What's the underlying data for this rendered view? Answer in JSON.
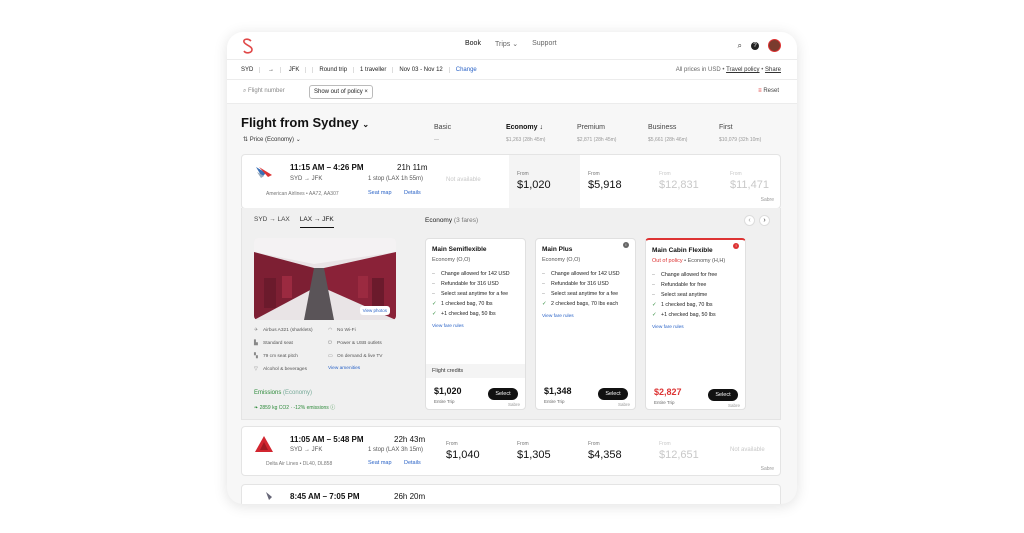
{
  "nav": {
    "links": [
      "Book",
      "Trips",
      "Support"
    ],
    "trips_chevron": "⌄"
  },
  "search": {
    "from": "SYD",
    "to": "JFK",
    "arrow": "→",
    "trip_type": "Round trip",
    "travellers": "1 traveller",
    "dates": "Nov 03 - Nov 12",
    "change": "Change",
    "currency_note": "All prices in USD",
    "dot": "•",
    "travel_policy": "Travel policy",
    "share": "Share"
  },
  "filters": {
    "flight_number_placeholder": "Flight number",
    "chip": "Show out of policy",
    "chip_close": "×",
    "reset": "Reset"
  },
  "page": {
    "title": "Flight from Sydney",
    "title_chevron": "⌄",
    "sort": "Price (Economy)"
  },
  "cabins": [
    {
      "name": "Basic",
      "sub": "—"
    },
    {
      "name": "Economy ↓",
      "sub": "$1,263 (28h 45m)"
    },
    {
      "name": "Premium",
      "sub": "$2,871 (28h 45m)"
    },
    {
      "name": "Business",
      "sub": "$5,661 (28h 46m)"
    },
    {
      "name": "First",
      "sub": "$10,079 (32h 10m)"
    }
  ],
  "flights": [
    {
      "time": "11:15 AM – 4:26 PM",
      "duration": "21h 11m",
      "route": "SYD → JFK",
      "stops": "1 stop (LAX 1h 55m)",
      "airline": "American Airlines • AA72, AA307",
      "seat_map": "Seat map",
      "details": "Details",
      "cells": [
        {
          "from": "",
          "price": "",
          "na": "Not available"
        },
        {
          "from": "From",
          "price": "$1,020"
        },
        {
          "from": "From",
          "price": "$5,918"
        },
        {
          "from": "From",
          "price": "$12,831"
        },
        {
          "from": "From",
          "price": "$11,471"
        }
      ],
      "provider": "Sabre"
    },
    {
      "time": "11:05 AM – 5:48 PM",
      "duration": "22h 43m",
      "route": "SYD → JFK",
      "stops": "1 stop (LAX 3h 15m)",
      "airline": "Delta Air Lines • DL40, DL858",
      "seat_map": "Seat map",
      "details": "Details",
      "cells": [
        {
          "from": "From",
          "price": "$1,040"
        },
        {
          "from": "From",
          "price": "$1,305"
        },
        {
          "from": "From",
          "price": "$4,358"
        },
        {
          "from": "From",
          "price": "$12,651"
        },
        {
          "from": "",
          "price": "",
          "na": "Not available"
        }
      ],
      "provider": "Sabre"
    },
    {
      "time": "8:45 AM – 7:05 PM",
      "duration": "26h 20m"
    }
  ],
  "expanded": {
    "tabs": [
      "SYD → LAX",
      "LAX → JFK"
    ],
    "view_photos": "View photos",
    "amenities": [
      {
        "icon": "plane",
        "text": "Airbus A321 (sharklets)"
      },
      {
        "icon": "wifi",
        "text": "No Wi-Fi"
      },
      {
        "icon": "seat",
        "text": "Standard seat"
      },
      {
        "icon": "power",
        "text": "Power & USB outlets"
      },
      {
        "icon": "pitch",
        "text": "79 cm seat pitch"
      },
      {
        "icon": "tv",
        "text": "On demand & live TV"
      },
      {
        "icon": "drink",
        "text": "Alcohol & beverages"
      },
      {
        "icon": "",
        "text": "View amenities"
      }
    ],
    "emissions_label": "Emissions",
    "emissions_cabin": "(Economy)",
    "emissions_value": "2859 kg CO2",
    "emissions_delta": "-12% emissions",
    "info_icon": "ⓘ",
    "fares_title": "Economy",
    "fares_count": "(3 fares)",
    "fares": [
      {
        "name": "Main Semiflexible",
        "sub": "Economy (O,O)",
        "features": [
          [
            "–",
            "Change allowed for 142 USD"
          ],
          [
            "–",
            "Refundable for 316 USD"
          ],
          [
            "–",
            "Select seat anytime for a fee"
          ],
          [
            "✓",
            "1 checked bag, 70 lbs"
          ],
          [
            "✓",
            "+1 checked bag, 50 lbs"
          ]
        ],
        "view_rules": "View fare rules",
        "credits": "Flight credits",
        "price": "$1,020",
        "trip": "Entire Trip",
        "select": "Select",
        "provider": "Sabre"
      },
      {
        "name": "Main Plus",
        "sub": "Economy (O,O)",
        "features": [
          [
            "–",
            "Change allowed for 142 USD"
          ],
          [
            "–",
            "Refundable for 316 USD"
          ],
          [
            "–",
            "Select seat anytime for a fee"
          ],
          [
            "✓",
            "2 checked bags, 70 lbs each"
          ]
        ],
        "view_rules": "View fare rules",
        "price": "$1,348",
        "trip": "Entire Trip",
        "select": "Select",
        "provider": "Sabre"
      },
      {
        "name": "Main Cabin Flexible",
        "policy": "Out of policy",
        "sub2": "• Economy (H,H)",
        "features": [
          [
            "–",
            "Change allowed for free"
          ],
          [
            "–",
            "Refundable for free"
          ],
          [
            "–",
            "Select seat anytime"
          ],
          [
            "✓",
            "1 checked bag, 70 lbs"
          ],
          [
            "✓",
            "+1 checked bag, 50 lbs"
          ]
        ],
        "view_rules": "View fare rules",
        "price": "$2,827",
        "trip": "Entire Trip",
        "select": "Select",
        "provider": "Sabre"
      }
    ]
  },
  "colors": {
    "brand": "#d33b3b",
    "link": "#2a63c7",
    "green": "#2d8a3a",
    "bg": "#f7f7f7"
  }
}
